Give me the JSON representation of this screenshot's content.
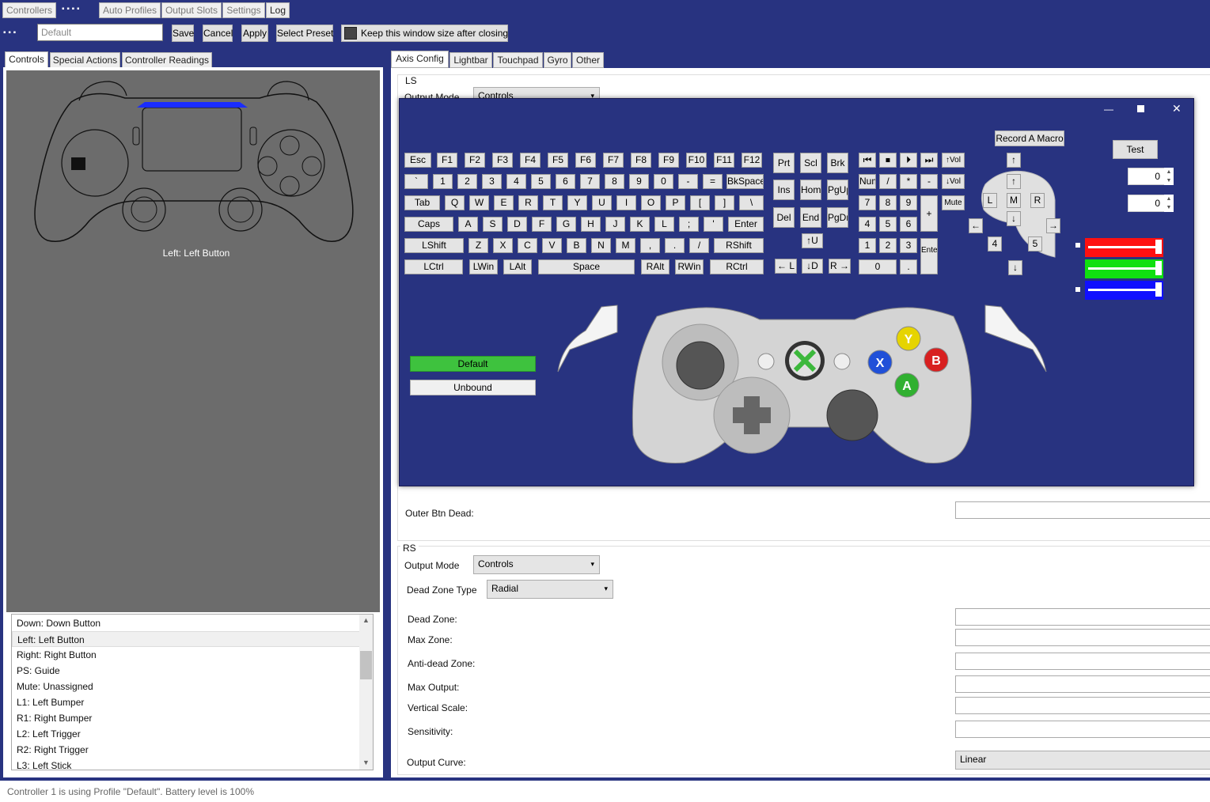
{
  "topTabs": [
    "Controllers",
    "Auto Profiles",
    "Output Slots",
    "Settings",
    "Log"
  ],
  "profile": {
    "name_value": "Default",
    "save": "Save",
    "cancel": "Cancel",
    "apply": "Apply",
    "select_preset": "Select Preset",
    "keep_size": "Keep this window size after closing"
  },
  "leftTabs": [
    "Controls",
    "Special Actions",
    "Controller Readings"
  ],
  "controllerPreview": {
    "hover_label": "Left: Left Button"
  },
  "mappingList": [
    "Down: Down Button",
    "Left: Left Button",
    "Right: Right Button",
    "PS: Guide",
    "Mute: Unassigned",
    "L1: Left Bumper",
    "R1: Right Bumper",
    "L2: Left Trigger",
    "R2: Right Trigger",
    "L3: Left Stick"
  ],
  "rightTabs": [
    "Axis Config",
    "Lightbar",
    "Touchpad",
    "Gyro",
    "Other"
  ],
  "ls": {
    "header": "LS",
    "output_mode_label": "Output Mode",
    "output_mode_value": "Controls",
    "outer_btn_dead": "Outer Btn Dead:"
  },
  "rs": {
    "header": "RS",
    "output_mode_label": "Output Mode",
    "output_mode_value": "Controls",
    "dead_zone_type_label": "Dead Zone Type",
    "dead_zone_type_value": "Radial",
    "dead_zone": "Dead Zone:",
    "max_zone": "Max Zone:",
    "anti_dead_zone": "Anti-dead Zone:",
    "max_output": "Max Output:",
    "vertical_scale": "Vertical Scale:",
    "sensitivity": "Sensitivity:",
    "output_curve": "Output Curve:",
    "output_curve_value": "Linear"
  },
  "popup": {
    "record_macro": "Record A Macro",
    "test": "Test",
    "spin1": "0",
    "spin2": "0",
    "default_btn": "Default",
    "unbound_btn": "Unbound",
    "keys_row1": [
      "Esc",
      "F1",
      "F2",
      "F3",
      "F4",
      "F5",
      "F6",
      "F7",
      "F8",
      "F9",
      "F10",
      "F11",
      "F12"
    ],
    "keys_row2": [
      "`",
      "1",
      "2",
      "3",
      "4",
      "5",
      "6",
      "7",
      "8",
      "9",
      "0",
      "-",
      "=",
      "BkSpace"
    ],
    "keys_row3": [
      "Tab",
      "Q",
      "W",
      "E",
      "R",
      "T",
      "Y",
      "U",
      "I",
      "O",
      "P",
      "[",
      "]",
      "\\"
    ],
    "keys_row4": [
      "Caps",
      "A",
      "S",
      "D",
      "F",
      "G",
      "H",
      "J",
      "K",
      "L",
      ";",
      "'",
      "Enter"
    ],
    "keys_row5": [
      "LShift",
      "Z",
      "X",
      "C",
      "V",
      "B",
      "N",
      "M",
      ",",
      ".",
      "/",
      "RShift"
    ],
    "keys_row6": [
      "LCtrl",
      "LWin",
      "LAlt",
      "Space",
      "RAlt",
      "RWin",
      "RCtrl"
    ],
    "nav_keys": [
      "Prt",
      "Scl",
      "Brk",
      "Ins",
      "Hom",
      "PgUp",
      "Del",
      "End",
      "PgDn",
      "↑U",
      "← L",
      "↓D",
      "R →"
    ],
    "media_keys": [
      "⏮",
      "⏹",
      "⏵",
      "⏭",
      "↑Vol",
      "↓Vol",
      "Mute"
    ],
    "numpad": [
      "Num",
      "/",
      "*",
      "-",
      "7",
      "8",
      "9",
      "+",
      "4",
      "5",
      "6",
      "1",
      "2",
      "3",
      "Enter",
      "0",
      "."
    ],
    "mouse": [
      "L",
      "M",
      "R",
      "4",
      "5",
      "↑",
      "↓",
      "←",
      "→"
    ]
  },
  "status": "Controller 1 is using Profile \"Default\". Battery level is 100%",
  "colors": {
    "bg": "#283380",
    "default_green": "#3ec23e",
    "red": "#ff1010",
    "green": "#10e010",
    "blue": "#1010ff"
  }
}
